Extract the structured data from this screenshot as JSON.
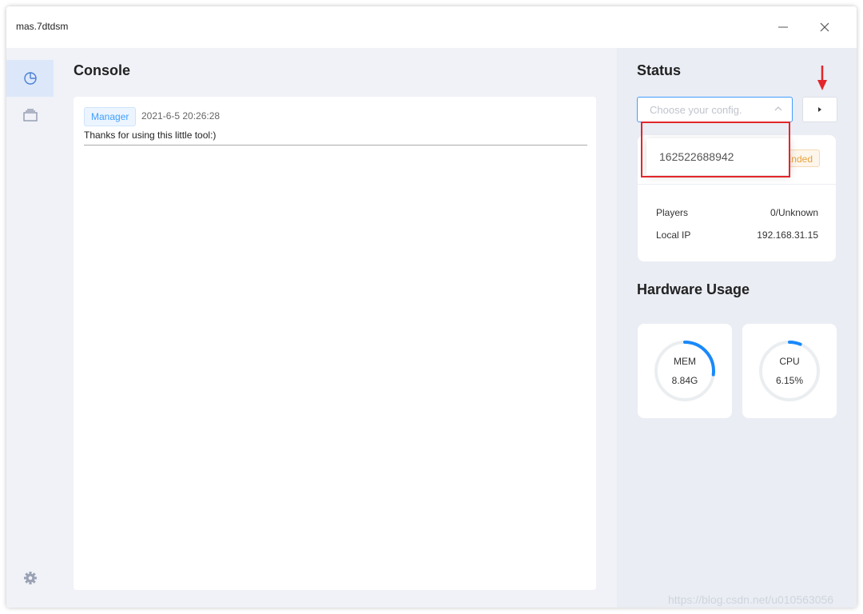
{
  "window": {
    "title": "mas.7dtdsm"
  },
  "sidebar": {
    "items": [
      {
        "name": "dashboard",
        "icon": "pie-chart-icon",
        "active": true
      },
      {
        "name": "archive",
        "icon": "archive-icon",
        "active": false
      }
    ],
    "settings_icon": "gear-icon"
  },
  "console": {
    "title": "Console",
    "logs": [
      {
        "tag": "Manager",
        "time": "2021-6-5 20:26:28",
        "message": "Thanks for using this little tool:)"
      }
    ]
  },
  "status": {
    "title": "Status",
    "config_placeholder": "Choose your config.",
    "dropdown_options": [
      "162522688942"
    ],
    "badge": "Ended",
    "players_label": "Players",
    "players_value": "0/Unknown",
    "ip_label": "Local IP",
    "ip_value": "192.168.31.15"
  },
  "hardware": {
    "title": "Hardware Usage",
    "mem": {
      "label": "MEM",
      "value": "8.84G",
      "fraction": 0.27
    },
    "cpu": {
      "label": "CPU",
      "value": "6.15%",
      "fraction": 0.0615
    }
  },
  "colors": {
    "accent": "#409eff",
    "highlight": "#e3262b",
    "warning": "#e6a23c"
  },
  "watermark": "https://blog.csdn.net/u010563056"
}
